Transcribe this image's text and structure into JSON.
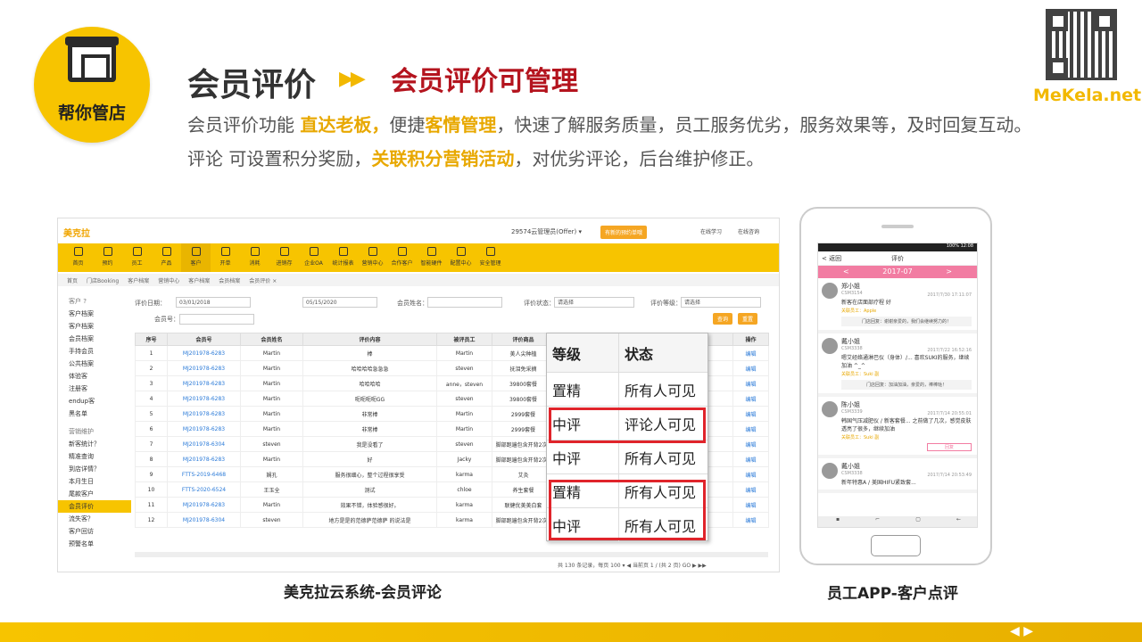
{
  "brand": {
    "label": "帮你管店"
  },
  "header": {
    "title": "会员评价",
    "subtitle": "会员评价可管理",
    "desc1": [
      "会员评价功能 ",
      "直达老板，",
      "便捷",
      "客情管理",
      "，快速了解服务质量，员工服务优劣，服务效果等，及时回复互动。"
    ],
    "desc2": [
      "评论 可设置积分奖励，",
      "关联积分营销活动",
      "，对优劣评论，后台维护修正。"
    ]
  },
  "site": "MeKela.net",
  "web": {
    "logo": "美克拉",
    "user": "29574云管理员(Offer) ▾",
    "order_btn": "有新的预约单哦",
    "study": "在线学习",
    "consult": "在线咨询",
    "nav": [
      "首页",
      "预约",
      "员工",
      "产品",
      "客户",
      "开单",
      "消耗",
      "进销存",
      "企业OA",
      "统计报表",
      "营销中心",
      "合作客户",
      "智能硬件",
      "配置中心",
      "安全管理"
    ],
    "nav_active": 4,
    "crumbs": [
      "首页",
      "门店Booking",
      "客户档案",
      "营销中心",
      "客户档案",
      "会员档案",
      "会员评价 ×"
    ],
    "side": [
      {
        "t": "客户 ?",
        "g": true
      },
      {
        "t": "客户档案"
      },
      {
        "t": "客户档案"
      },
      {
        "t": "会员档案"
      },
      {
        "t": "手持会员"
      },
      {
        "t": "公共档案"
      },
      {
        "t": "体验客"
      },
      {
        "t": "注册客"
      },
      {
        "t": "endup客"
      },
      {
        "t": "黑名单"
      },
      {
        "t": "营销维护",
        "g": true
      },
      {
        "t": "新客统计？"
      },
      {
        "t": "精准查询"
      },
      {
        "t": "到店详情？"
      },
      {
        "t": "本月生日"
      },
      {
        "t": "尾款客户"
      },
      {
        "t": "会员评价",
        "on": true
      },
      {
        "t": "流失客？"
      },
      {
        "t": "客户回访"
      },
      {
        "t": "预警名单"
      }
    ],
    "filter": {
      "date_label": "评价日期：",
      "date_from": "03/01/2018",
      "date_to": "05/15/2020",
      "name_label": "会员姓名：",
      "status_label": "评价状态：",
      "status_val": "请选择",
      "level_label": "评价等级：",
      "level_val": "请选择",
      "no_label": "会员号：",
      "query": "查询",
      "reset": "重置"
    },
    "columns": [
      "序号",
      "会员号",
      "会员姓名",
      "评价内容",
      "被评员工",
      "评价商品",
      "",
      "操作"
    ],
    "rows": [
      [
        "1",
        "MJ201978-6283",
        "Martin",
        "棒",
        "Martin",
        "美人尖种植",
        "7:28",
        "编辑"
      ],
      [
        "2",
        "MJ201978-6283",
        "Martin",
        "哈哈哈哈急急急",
        "steven",
        "抚泪免采摘",
        "7:26",
        "编辑"
      ],
      [
        "3",
        "MJ201978-6283",
        "Martin",
        "哈哈哈哈",
        "anne，steven",
        "39800套餐",
        "0:09",
        "编辑"
      ],
      [
        "4",
        "MJ201978-6283",
        "Martin",
        "呃呃呃呃GG",
        "steven",
        "39800套餐",
        "4:28",
        "编辑"
      ],
      [
        "5",
        "MJ201978-6283",
        "Martin",
        "非常棒",
        "Martin",
        "2999套餐",
        "2:04",
        "编辑"
      ],
      [
        "6",
        "MJ201978-6283",
        "Martin",
        "非常棒",
        "Martin",
        "2999套餐",
        "8:44",
        "编辑"
      ],
      [
        "7",
        "MJ201978-6304",
        "steven",
        "我是没看了",
        "steven",
        "脚部跑遍包含开背2次1",
        "5:02",
        "编辑"
      ],
      [
        "8",
        "MJ201978-6283",
        "Martin",
        "好",
        "Jacky",
        "脚部跑遍包含开背2次1",
        "3:28",
        "编辑"
      ],
      [
        "9",
        "FTTS-2019-6468",
        "娴孔",
        "服务很细心，整个过程很享受",
        "karma",
        "艾灸",
        "5:29",
        "编辑"
      ],
      [
        "10",
        "FTTS-2020-6524",
        "王玉全",
        "测试",
        "chloe",
        "养生套餐",
        "6:39",
        "编辑"
      ],
      [
        "11",
        "MJ201978-6283",
        "Martin",
        "效果不错，体验感很好。",
        "karma",
        "联健优美美白套",
        "7:21",
        "编辑"
      ],
      [
        "12",
        "MJ201978-6304",
        "steven",
        "地方是是的范德萨范德萨 的说法是",
        "karma",
        "脚部跑遍包含开背2次1",
        "7:30",
        "编辑"
      ]
    ],
    "pager": "共 130 条记录，每页 100 ▾  ◀  当前页 1  / (共 2 页)  GO ▶ ▶▶"
  },
  "popup": {
    "head": [
      "等级",
      "状态"
    ],
    "rows": [
      [
        "置精",
        "所有人可见"
      ],
      [
        "中评",
        "评论人可见"
      ],
      [
        "中评",
        "所有人可见"
      ],
      [
        "置精",
        "所有人可见"
      ],
      [
        "中评",
        "所有人可见"
      ]
    ]
  },
  "captions": {
    "web": "美克拉云系统-会员评论",
    "app": "员工APP-客户点评"
  },
  "phone": {
    "status": "100% 12:08",
    "title": "评价",
    "back": "< 返回",
    "month": "2017-07",
    "prev": "<",
    "next": ">",
    "reviews": [
      {
        "name": "郑小姐",
        "id": "CSM3154",
        "time": "2017/7/30 17:11:07",
        "text": "新客在店面部疗程 好",
        "emp": "关联员工：Apple",
        "reply": "门店回复：谢谢亲爱的，我们会继续努力的！"
      },
      {
        "name": "戴小姐",
        "id": "CSM3338",
        "time": "2017/7/22 16:52:16",
        "text": "嗯艾经络通淋巴仪（身体）/... 喜欢SUKI的服务，继续加油 ^_^",
        "emp": "关联员工：Suki 副",
        "reply": "门店回复：加油加油，亲爱的，棒棒哒！"
      },
      {
        "name": "陈小姐",
        "id": "CSM3339",
        "time": "2017/7/14 20:55:01",
        "text": "韩国气压减肥仪 / 新客套餐... 之前做了几次，感觉皮肤透亮了很多，继续加油",
        "emp": "关联员工：Suki 副",
        "btn": "回复"
      },
      {
        "name": "戴小姐",
        "id": "CSM3338",
        "time": "2017/7/14 20:53:49",
        "text": "新年特惠A / 美国HIFU紧致套..."
      }
    ],
    "navbar": [
      "▪",
      "⌐",
      "▢",
      "←"
    ]
  }
}
